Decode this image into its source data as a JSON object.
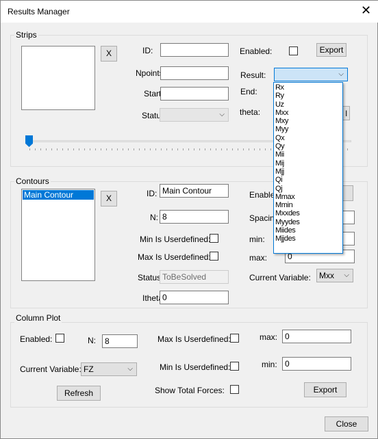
{
  "window": {
    "title": "Results Manager",
    "close_icon": "close-icon"
  },
  "strips": {
    "label": "Strips",
    "remove": "X",
    "id_label": "ID:",
    "id_value": "",
    "npoints_label": "Npoints:",
    "npoints_value": "",
    "start_label": "Start:",
    "start_value": "",
    "status_label": "Status:",
    "status_value": "",
    "enabled_label": "Enabled:",
    "enabled_checked": false,
    "export": "Export",
    "result_label": "Result:",
    "result_value": "",
    "end_label": "End:",
    "theta_label": "theta:",
    "hidden_button": "l",
    "slider_value": 0,
    "result_options": [
      "Rx",
      "Ry",
      "Uz",
      "Mxx",
      "Mxy",
      "Myy",
      "Qx",
      "Qy",
      "Mii",
      "Mij",
      "Mjj",
      "Qi",
      "Qj",
      "Mmax",
      "Mmin",
      "Mxxdes",
      "Myydes",
      "Miides",
      "Mjjdes"
    ]
  },
  "contours": {
    "label": "Contours",
    "remove": "X",
    "list_items": [
      "Main Contour"
    ],
    "id_label": "ID:",
    "id_value": "Main Contour",
    "n_label": "N:",
    "n_value": "8",
    "min_user_label": "Min Is Userdefined:",
    "max_user_label": "Max Is Userdefined:",
    "status_label": "Status:",
    "status_value": "ToBeSolved",
    "itheta_label": "Itheta:",
    "itheta_value": "0",
    "enabled_label": "Enable",
    "spacing_label": "Spacing",
    "min_label": "min:",
    "max_label": "max:",
    "max_value": "0",
    "current_var_label": "Current Variable:",
    "current_var_value": "Mxx"
  },
  "column_plot": {
    "label": "Column Plot",
    "enabled_label": "Enabled:",
    "n_label": "N:",
    "n_value": "8",
    "max_user_label": "Max Is Userdefined:",
    "max_label": "max:",
    "max_value": "0",
    "current_var_label": "Current Variable:",
    "current_var_value": "FZ",
    "min_user_label": "Min Is Userdefined:",
    "min_label": "min:",
    "min_value": "0",
    "refresh": "Refresh",
    "show_total_label": "Show Total Forces:",
    "export": "Export"
  },
  "footer": {
    "close": "Close"
  },
  "colors": {
    "accent": "#0078d7",
    "selection": "#0078d7",
    "combo_highlight": "#cce4f7"
  }
}
